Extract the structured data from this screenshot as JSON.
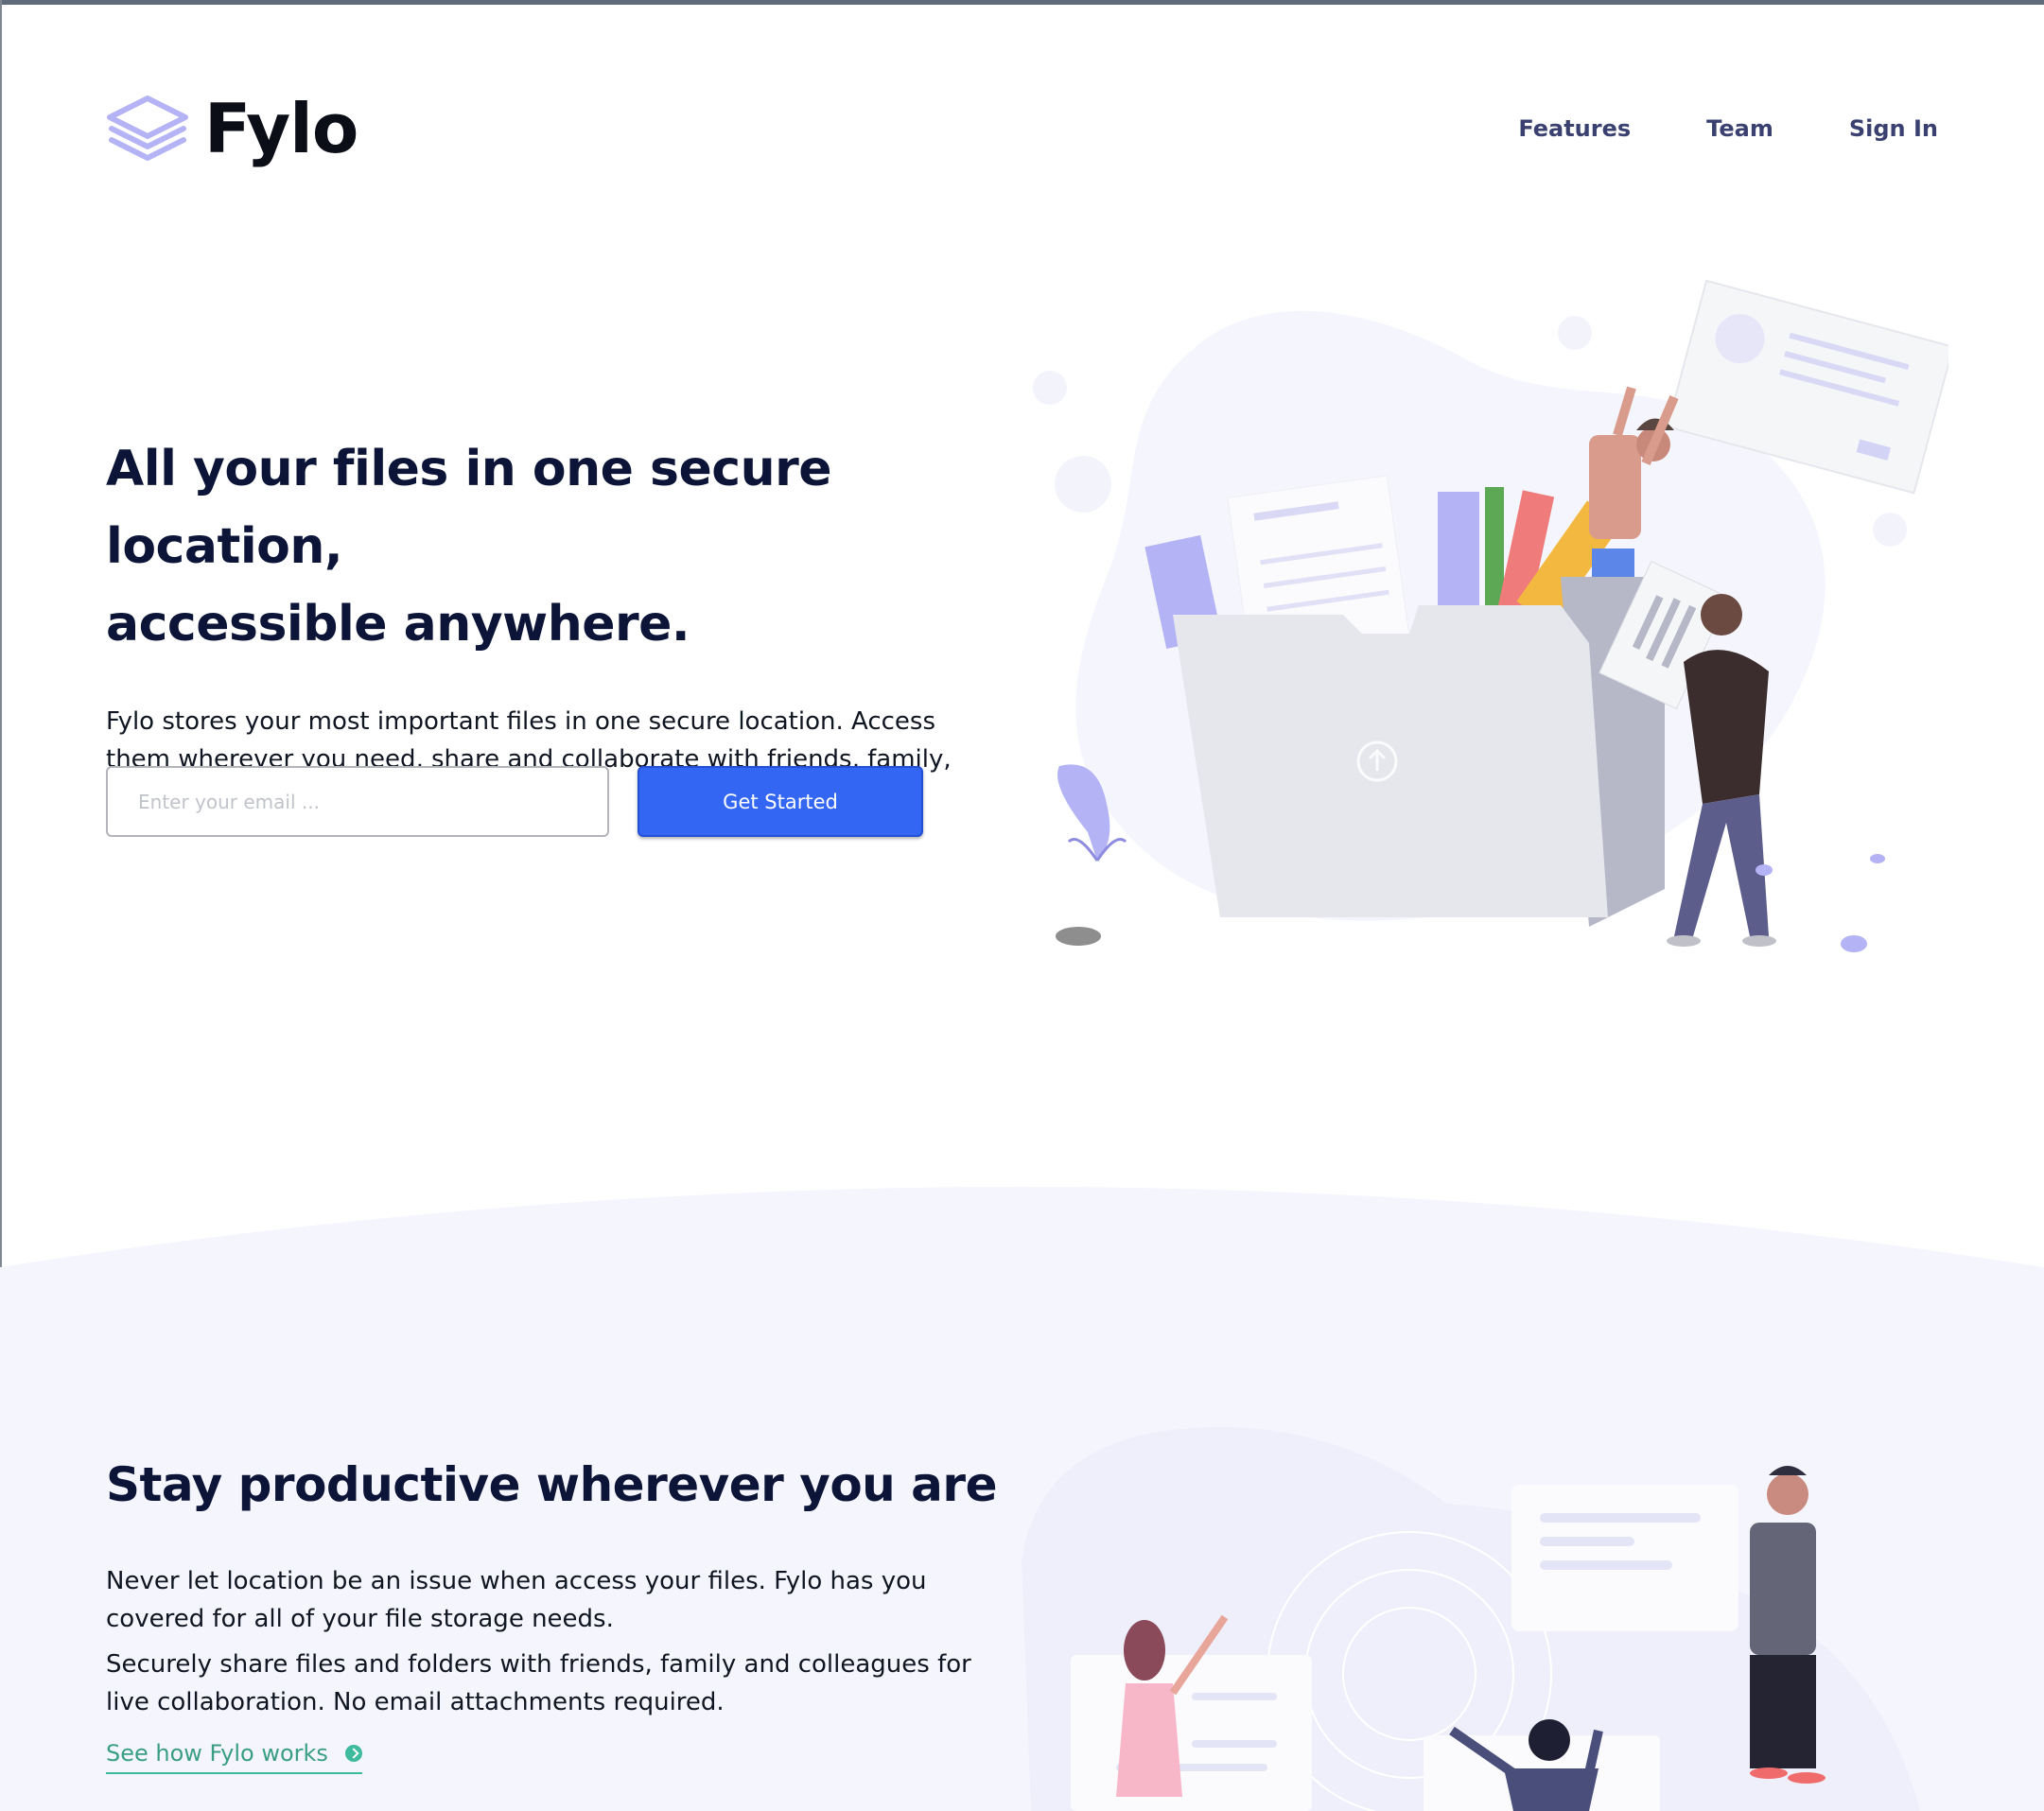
{
  "brand": {
    "name": "Fylo",
    "logo_icon": "stacked-layers-icon"
  },
  "nav": {
    "items": [
      "Features",
      "Team",
      "Sign In"
    ]
  },
  "hero": {
    "title_line1": "All your files in one secure location,",
    "title_line2": "accessible anywhere.",
    "description": "Fylo stores your most important files in one secure location. Access them wherever you need, share and collaborate with friends, family, and co-workers.",
    "email_placeholder": "Enter your email ...",
    "cta_label": "Get Started"
  },
  "productive": {
    "title": "Stay productive wherever you are",
    "paragraph1": "Never let location be an issue when access your files. Fylo has you covered for all of your file storage needs.",
    "paragraph2": "Securely share files and folders with friends, family and colleagues for live collaboration. No email attachments required.",
    "link_label": "See how Fylo works",
    "link_icon": "arrow-circle-icon"
  },
  "colors": {
    "primary": "#3266f3",
    "heading": "#0c1437",
    "nav": "#3a4170",
    "accent_teal": "#3ebb9f",
    "logo_purple": "#b4b3f5",
    "section_bg": "#f5f6fd"
  }
}
